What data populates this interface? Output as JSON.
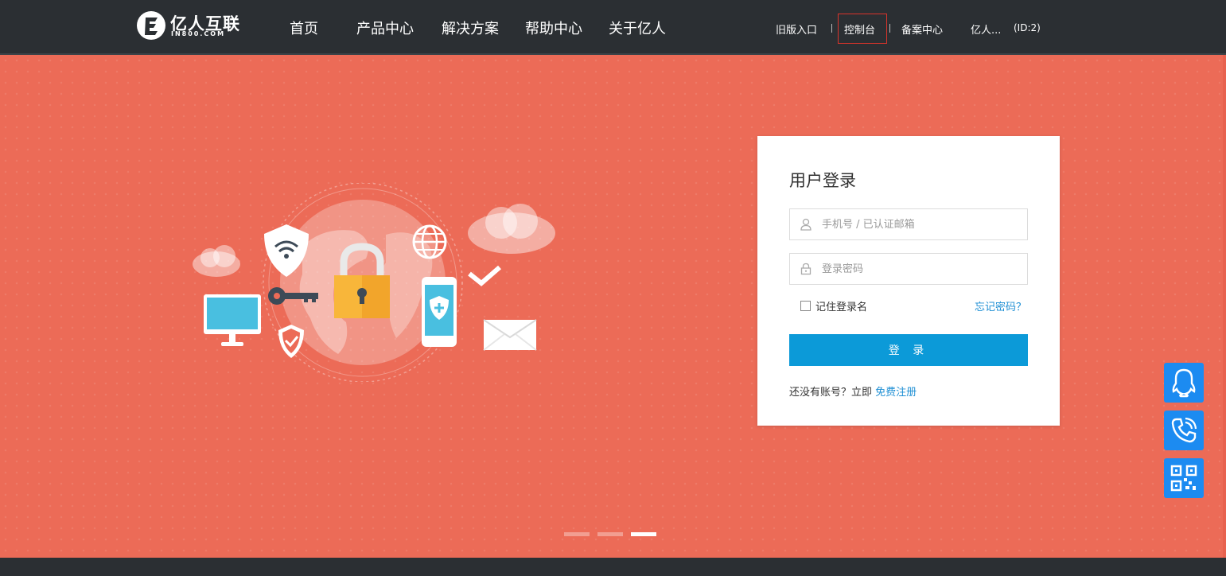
{
  "header": {
    "logo": {
      "text": "亿人互联",
      "sub": "IN800.COM"
    },
    "nav": [
      "首页",
      "产品中心",
      "解决方案",
      "帮助中心",
      "关于亿人"
    ],
    "top_links": {
      "old_version": "旧版入口",
      "console": "控制台",
      "record_center": "备案中心",
      "user": "亿人...",
      "user_id": "(ID:2)"
    }
  },
  "login": {
    "title": "用户登录",
    "username_placeholder": "手机号 / 已认证邮箱",
    "username_value": "",
    "password_placeholder": "登录密码",
    "password_value": "",
    "remember_label": "记住登录名",
    "remember_checked": false,
    "forgot_label": "忘记密码？",
    "submit_label": "登 录",
    "register_prompt": "还没有账号？立即",
    "register_link": "免费注册"
  },
  "carousel": {
    "count": 3,
    "active_index": 2
  },
  "side_tools": [
    "qq-icon",
    "phone-icon",
    "qrcode-icon"
  ],
  "colors": {
    "header_bg": "#2b2f33",
    "banner_bg": "#ec6b57",
    "primary_button": "#0c9ad8",
    "link": "#1f8fd4",
    "side_button": "#1c8bf1",
    "console_highlight": "#d9342b"
  }
}
